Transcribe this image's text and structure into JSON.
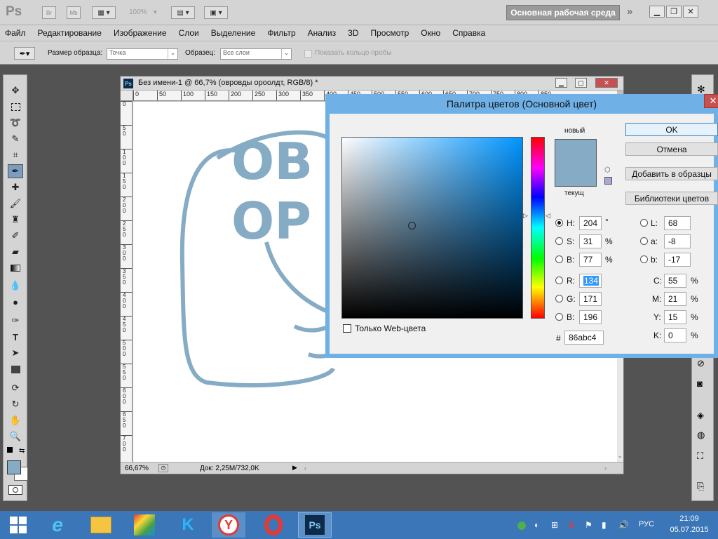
{
  "app": {
    "logo": "Ps",
    "bridge_label": "Br",
    "minibridge_label": "Mb",
    "zoom_level": "100%",
    "workspace_button": "Основная рабочая среда",
    "more_label": "»"
  },
  "menu": [
    "Файл",
    "Редактирование",
    "Изображение",
    "Слои",
    "Выделение",
    "Фильтр",
    "Анализ",
    "3D",
    "Просмотр",
    "Окно",
    "Справка"
  ],
  "options": {
    "sample_size_label": "Размер образца:",
    "sample_size_value": "Точка",
    "sample_label": "Образец:",
    "sample_value": "Все слои",
    "show_ring_label": "Показать кольцо пробы"
  },
  "document": {
    "title": "Без имени-1 @ 66,7% (овровды ороолдт, RGB/8) *",
    "canvas_text_line1": "ОВ",
    "canvas_text_line2": "ОР",
    "zoom": "66,67%",
    "doc_info": "Док: 2,25M/732,0K",
    "ruler_top": [
      "0",
      "50",
      "100",
      "150",
      "200",
      "250",
      "300",
      "350",
      "400",
      "450",
      "500",
      "550",
      "600",
      "650",
      "700",
      "750",
      "800",
      "850"
    ],
    "ruler_left": [
      "0",
      "50",
      "100",
      "150",
      "200",
      "250",
      "300",
      "350",
      "400",
      "450",
      "500",
      "550",
      "600",
      "650",
      "700"
    ]
  },
  "picker": {
    "title": "Палитра цветов (Основной цвет)",
    "new_label": "новый",
    "current_label": "текущ",
    "ok": "OK",
    "cancel": "Отмена",
    "add_swatch": "Добавить в образцы",
    "libraries": "Библиотеки цветов",
    "web_only": "Только Web-цвета",
    "H": {
      "label": "H:",
      "value": "204",
      "unit": "°"
    },
    "S": {
      "label": "S:",
      "value": "31",
      "unit": "%"
    },
    "B": {
      "label": "B:",
      "value": "77",
      "unit": "%"
    },
    "R": {
      "label": "R:",
      "value": "134"
    },
    "G": {
      "label": "G:",
      "value": "171"
    },
    "Bl": {
      "label": "B:",
      "value": "196"
    },
    "L": {
      "label": "L:",
      "value": "68"
    },
    "a": {
      "label": "a:",
      "value": "-8"
    },
    "b": {
      "label": "b:",
      "value": "-17"
    },
    "C": {
      "label": "C:",
      "value": "55",
      "unit": "%"
    },
    "M": {
      "label": "M:",
      "value": "21",
      "unit": "%"
    },
    "Y": {
      "label": "Y:",
      "value": "15",
      "unit": "%"
    },
    "K": {
      "label": "K:",
      "value": "0",
      "unit": "%"
    },
    "hex_label": "#",
    "hex": "86abc4",
    "color": "#86abc4"
  },
  "taskbar": {
    "language": "РУС",
    "time": "21:09",
    "date": "05.07.2015"
  },
  "colors": {
    "accent": "#6fb0e6",
    "foreground": "#86abc4"
  }
}
